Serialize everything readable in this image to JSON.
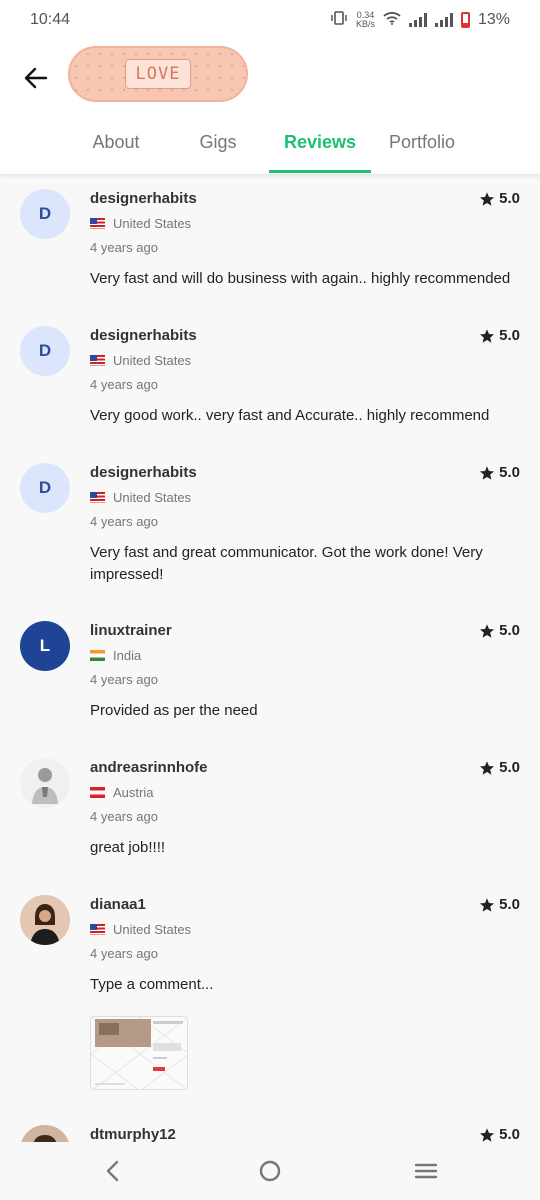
{
  "status_bar": {
    "time": "10:44",
    "net_speed_value": "0.34",
    "net_speed_unit": "KB/s",
    "battery": "13%",
    "icons": [
      "vibrate-icon",
      "wifi-icon",
      "signal-icon",
      "signal-icon",
      "battery-icon"
    ]
  },
  "header": {
    "logo_text": "LOVE",
    "tabs": [
      {
        "label": "About",
        "active": false
      },
      {
        "label": "Gigs",
        "active": false
      },
      {
        "label": "Reviews",
        "active": true
      },
      {
        "label": "Portfolio",
        "active": false
      }
    ]
  },
  "colors": {
    "accent": "#1dbf73",
    "muted": "#74767e",
    "avatar_d_bg": "#dbe6fd",
    "avatar_l_bg": "#1f4395"
  },
  "reviews": [
    {
      "initial": "D",
      "name": "designerhabits",
      "rating": "5.0",
      "country": "United States",
      "time": "4 years ago",
      "comment": "Very fast and will do business with again.. highly recommended"
    },
    {
      "initial": "D",
      "name": "designerhabits",
      "rating": "5.0",
      "country": "United States",
      "time": "4 years ago",
      "comment": "Very good work.. very fast and Accurate.. highly recommend"
    },
    {
      "initial": "D",
      "name": "designerhabits",
      "rating": "5.0",
      "country": "United States",
      "time": "4 years ago",
      "comment": "Very fast and great communicator. Got the work done! Very impressed!"
    },
    {
      "initial": "L",
      "name": "linuxtrainer",
      "rating": "5.0",
      "country": "India",
      "time": "4 years ago",
      "comment": "Provided as per the need"
    },
    {
      "initial": "",
      "name": "andreasrinnhofe",
      "rating": "5.0",
      "country": "Austria",
      "time": "4 years ago",
      "comment": "great job!!!!"
    },
    {
      "initial": "",
      "name": "dianaa1",
      "rating": "5.0",
      "country": "United States",
      "time": "4 years ago",
      "comment": "Type a comment..."
    },
    {
      "initial": "",
      "name": "dtmurphy12",
      "rating": "5.0"
    }
  ]
}
